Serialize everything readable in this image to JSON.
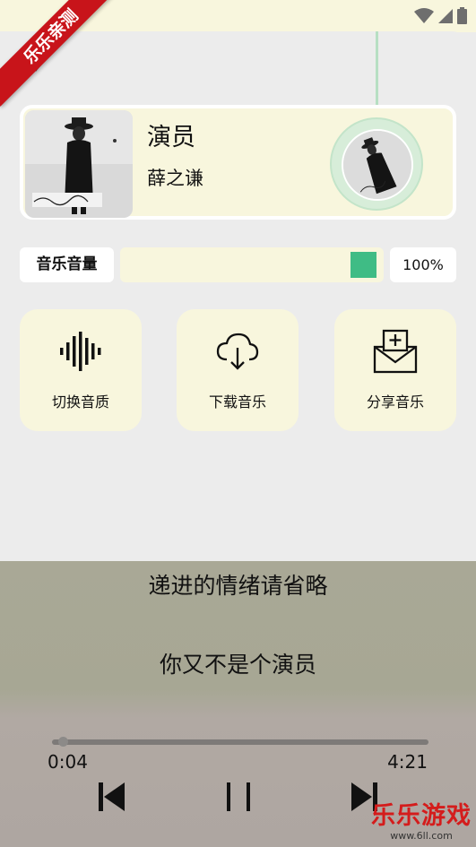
{
  "watermark": {
    "corner_label": "乐乐亲测",
    "brand": "乐乐游戏",
    "url": "www.6ll.com"
  },
  "status_bar": {
    "icons": [
      "wifi-icon",
      "cellular-icon",
      "battery-icon"
    ]
  },
  "song": {
    "title": "演员",
    "artist": "薛之谦"
  },
  "volume": {
    "label": "音乐音量",
    "value_text": "100%",
    "level": 1.0
  },
  "actions": [
    {
      "label": "切换音质",
      "icon": "waveform-icon"
    },
    {
      "label": "下载音乐",
      "icon": "cloud-download-icon"
    },
    {
      "label": "分享音乐",
      "icon": "share-mail-icon"
    }
  ],
  "lyrics": {
    "line1": "递进的情绪请省略",
    "line2": "你又不是个演员"
  },
  "playback": {
    "current_time": "0:04",
    "total_time": "4:21",
    "progress": 0.016
  },
  "colors": {
    "accent_green": "#3fbc85",
    "card_cream": "#f8f6dd",
    "panel_gray": "#ececec"
  }
}
